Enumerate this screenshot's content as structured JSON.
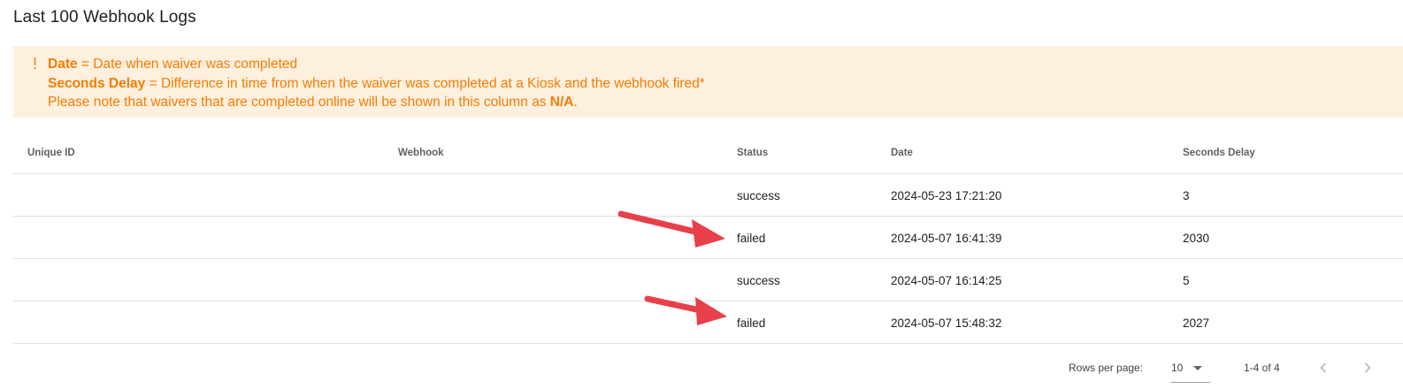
{
  "page": {
    "title": "Last 100 Webhook Logs"
  },
  "alert": {
    "icon": "!",
    "line1_bold": "Date",
    "line1_rest": " = Date when waiver was completed",
    "line2_bold": "Seconds Delay",
    "line2_rest": " = Difference in time from when the waiver was completed at a Kiosk and the webhook fired*",
    "line3_pre": "Please note that waivers that are completed online will be shown in this column as ",
    "line3_bold": "N/A",
    "line3_post": "."
  },
  "table": {
    "headers": {
      "unique_id": "Unique ID",
      "webhook": "Webhook",
      "status": "Status",
      "date": "Date",
      "seconds_delay": "Seconds Delay"
    },
    "rows": [
      {
        "unique_id": "",
        "webhook": "",
        "status": "success",
        "date": "2024-05-23 17:21:20",
        "seconds_delay": "3"
      },
      {
        "unique_id": "",
        "webhook": "",
        "status": "failed",
        "date": "2024-05-07 16:41:39",
        "seconds_delay": "2030"
      },
      {
        "unique_id": "",
        "webhook": "",
        "status": "success",
        "date": "2024-05-07 16:14:25",
        "seconds_delay": "5"
      },
      {
        "unique_id": "",
        "webhook": "",
        "status": "failed",
        "date": "2024-05-07 15:48:32",
        "seconds_delay": "2027"
      }
    ]
  },
  "pagination": {
    "rows_per_page_label": "Rows per page:",
    "rows_per_page_value": "10",
    "range": "1-4 of 4",
    "prev_icon": "chevron-left-icon",
    "next_icon": "chevron-right-icon"
  },
  "annotations": {
    "arrow_color": "#e8404a"
  },
  "colors": {
    "alert_bg": "#fdf0df",
    "alert_text": "#f57c00"
  }
}
